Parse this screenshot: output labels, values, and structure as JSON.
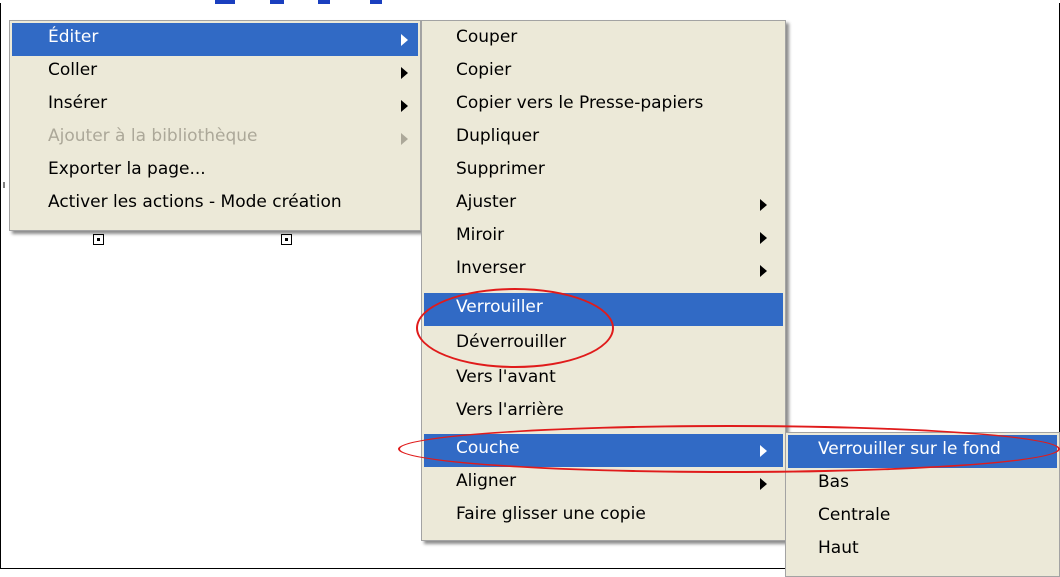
{
  "menu_main": {
    "items": [
      {
        "label": "Éditer",
        "submenu": true,
        "highlighted": true
      },
      {
        "label": "Coller",
        "submenu": true
      },
      {
        "label": "Insérer",
        "submenu": true
      },
      {
        "label": "Ajouter à la bibliothèque",
        "submenu": true,
        "disabled": true
      },
      {
        "label": "Exporter la page..."
      },
      {
        "label": "Activer les actions - Mode création"
      }
    ]
  },
  "menu_edit": {
    "items": [
      {
        "label": "Couper"
      },
      {
        "label": "Copier"
      },
      {
        "label": "Copier vers le Presse-papiers"
      },
      {
        "label": "Dupliquer"
      },
      {
        "label": "Supprimer"
      },
      {
        "label": "Ajuster",
        "submenu": true
      },
      {
        "label": "Miroir",
        "submenu": true
      },
      {
        "label": "Inverser",
        "submenu": true
      },
      {
        "label": "Verrouiller",
        "highlighted": true
      },
      {
        "label": "Déverrouiller"
      },
      {
        "label": "Vers l'avant"
      },
      {
        "label": "Vers l'arrière"
      },
      {
        "label": "Couche",
        "submenu": true,
        "highlighted": true
      },
      {
        "label": "Aligner",
        "submenu": true
      },
      {
        "label": "Faire glisser une copie"
      }
    ]
  },
  "menu_layer": {
    "items": [
      {
        "label": "Verrouiller sur le fond",
        "highlighted": true
      },
      {
        "label": "Bas"
      },
      {
        "label": "Centrale"
      },
      {
        "label": "Haut"
      }
    ]
  },
  "colors": {
    "menu_bg": "#ece9d8",
    "highlight": "#316ac5",
    "annotation": "#e01b1b"
  }
}
